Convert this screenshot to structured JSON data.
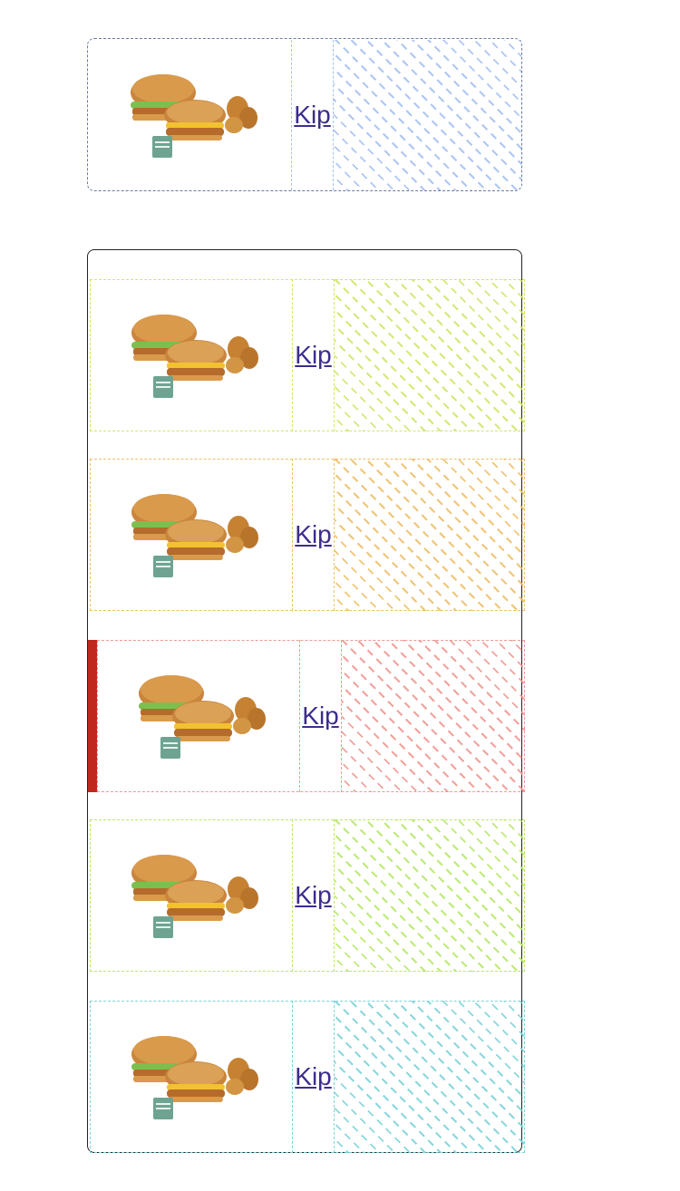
{
  "colors": {
    "top": "#a7c2f2",
    "item1": "#d3e56a",
    "item2": "#efbf6a",
    "item3": "#ef9a93",
    "item4": "#b8e86a",
    "item5": "#7fd3da",
    "active_indicator": "#c0281d",
    "link": "#3d2c8d"
  },
  "featured": {
    "image_alt": "Burger and nuggets meal",
    "link_label": "Kip"
  },
  "list": {
    "items": [
      {
        "image_alt": "Burger and nuggets meal",
        "link_label": "Kip",
        "active": false
      },
      {
        "image_alt": "Burger and nuggets meal",
        "link_label": "Kip",
        "active": false
      },
      {
        "image_alt": "Burger and nuggets meal",
        "link_label": "Kip",
        "active": true
      },
      {
        "image_alt": "Burger and nuggets meal",
        "link_label": "Kip",
        "active": false
      },
      {
        "image_alt": "Burger and nuggets meal",
        "link_label": "Kip",
        "active": false
      }
    ]
  }
}
